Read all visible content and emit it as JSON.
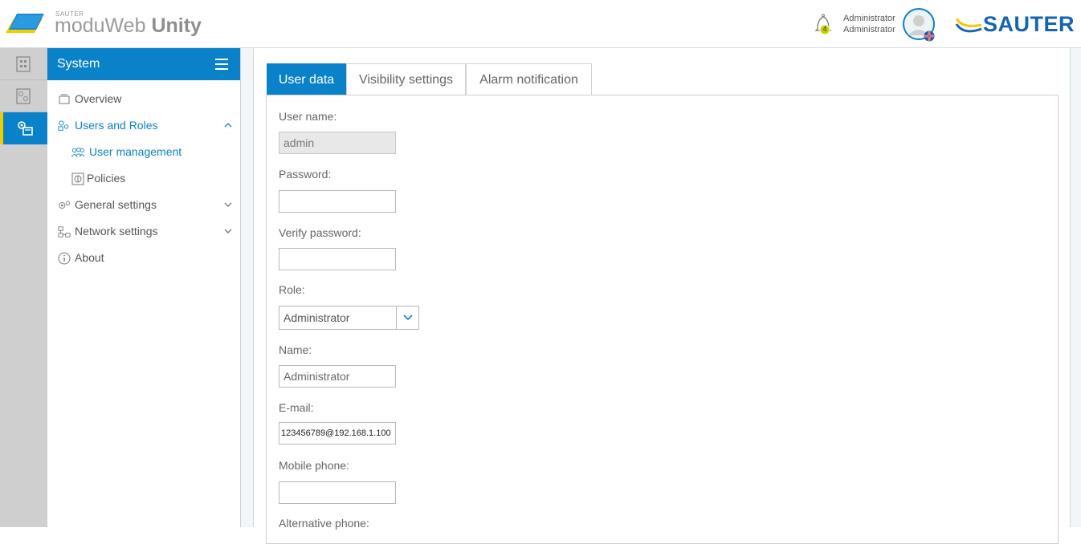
{
  "header": {
    "brand_small": "SAUTER",
    "brand_light": "moduWeb ",
    "brand_bold": "Unity",
    "notification_count": "4",
    "user_name": "Administrator",
    "user_role": "Administrator",
    "company_logo": "SAUTER"
  },
  "sidebar": {
    "title": "System",
    "items": [
      {
        "label": "Overview"
      },
      {
        "label": "Users and Roles"
      },
      {
        "label": "User management"
      },
      {
        "label": "Policies"
      },
      {
        "label": "General settings"
      },
      {
        "label": "Network settings"
      },
      {
        "label": "About"
      }
    ]
  },
  "tabs": [
    {
      "label": "User data"
    },
    {
      "label": "Visibility settings"
    },
    {
      "label": "Alarm notification"
    }
  ],
  "form": {
    "username_label": "User name:",
    "username_value": "admin",
    "password_label": "Password:",
    "password_value": "",
    "verify_label": "Verify password:",
    "verify_value": "",
    "role_label": "Role:",
    "role_value": "Administrator",
    "name_label": "Name:",
    "name_value": "Administrator",
    "email_label": "E-mail:",
    "email_value": "123456789@192.168.1.100",
    "mobile_label": "Mobile phone:",
    "mobile_value": "",
    "alt_phone_label": "Alternative phone:"
  },
  "colors": {
    "accent": "#0a82c9",
    "rail_indicator": "#f2cc00",
    "brand_blue": "#1565b0"
  }
}
